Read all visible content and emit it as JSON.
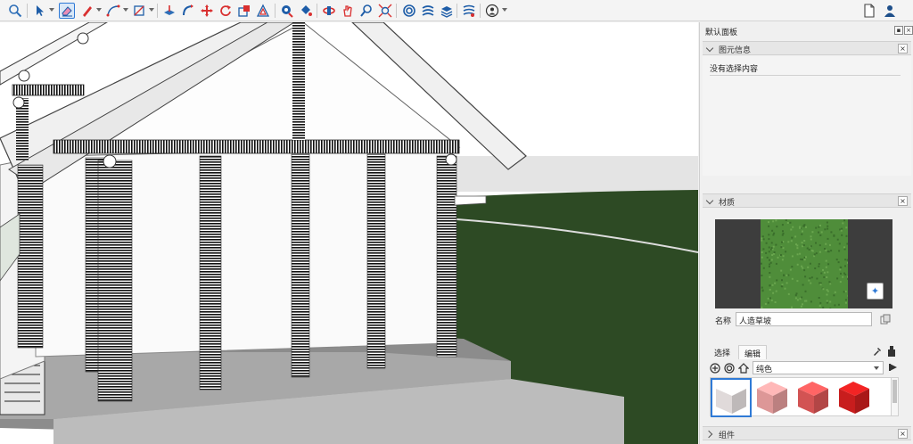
{
  "toolbar": {
    "tools": [
      {
        "icon": "zoom-icon"
      },
      {
        "icon": "select-arrow-icon"
      },
      {
        "icon": "eraser-icon",
        "active": true
      },
      {
        "icon": "pencil-line-icon"
      },
      {
        "icon": "arc-icon"
      },
      {
        "icon": "rectangle-icon"
      },
      {
        "icon": "push-pull-icon"
      },
      {
        "icon": "follow-me-icon"
      },
      {
        "icon": "move-icon"
      },
      {
        "icon": "rotate-icon"
      },
      {
        "icon": "scale-icon"
      },
      {
        "icon": "offset-icon"
      },
      {
        "icon": "tape-measure-icon"
      },
      {
        "icon": "paint-bucket-icon"
      },
      {
        "icon": "orbit-icon"
      },
      {
        "icon": "pan-icon"
      },
      {
        "icon": "zoom-tool-icon"
      },
      {
        "icon": "zoom-extents-icon"
      },
      {
        "icon": "sandbox-icon"
      },
      {
        "icon": "solid-tools-icon"
      },
      {
        "icon": "layers-icon"
      },
      {
        "icon": "section-icon"
      },
      {
        "icon": "user-circle-icon"
      },
      {
        "icon": "document-icon"
      },
      {
        "icon": "account-icon"
      }
    ]
  },
  "panel": {
    "title": "默认面板",
    "entity_info": {
      "heading": "图元信息",
      "empty_text": "没有选择内容"
    },
    "materials": {
      "heading": "材质",
      "name_label": "名称",
      "name_value": "人造草坡",
      "tab_select": "选择",
      "tab_edit": "编辑",
      "library_value": "纯色",
      "swatches": [
        {
          "color": "#f3eded",
          "selected": true
        },
        {
          "color": "#f0a4a4"
        },
        {
          "color": "#e45a5a"
        },
        {
          "color": "#d92020"
        }
      ],
      "texture_color": "#4f8d3a"
    },
    "components": {
      "heading": "组件"
    }
  }
}
